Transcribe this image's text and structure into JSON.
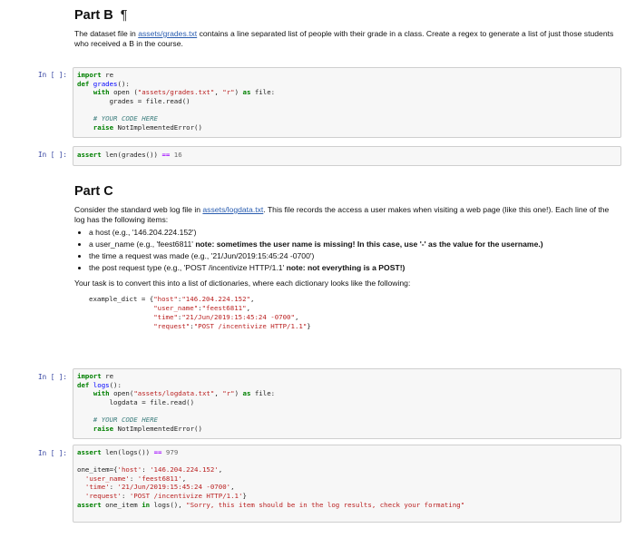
{
  "partB": {
    "title": "Part B",
    "pilcrow": "¶",
    "desc_pre": "The dataset file in ",
    "desc_link": "assets/grades.txt",
    "desc_post": " contains a line separated list of people with their grade in a class. Create a regex to generate a list of just those students who received a B in the course."
  },
  "prompts": {
    "cell": "In [ ]:"
  },
  "cell1": {
    "l1_kw": "import",
    "l1_rest": " re",
    "l2_kw": "def",
    "l2_fn": " grades",
    "l2_rest": "():",
    "l3_indent": "    ",
    "l3_kw": "with",
    "l3_a": " open (",
    "l3_s1": "\"assets/grades.txt\"",
    "l3_b": ", ",
    "l3_s2": "\"r\"",
    "l3_c": ") ",
    "l3_kw2": "as",
    "l3_d": " file:",
    "l4": "        grades = file.read()",
    "l6": "    # YOUR CODE HERE",
    "l7_kw": "    raise",
    "l7_rest": " NotImplementedError()"
  },
  "cell2": {
    "kw": "assert",
    "a": " len(grades()) ",
    "op": "==",
    "num": " 16"
  },
  "partC": {
    "title": "Part C",
    "p1_pre": "Consider the standard web log file in ",
    "p1_link": "assets/logdata.txt",
    "p1_post": ". This file records the access a user makes when visiting a web page (like this one!). Each line of the log has the following items:",
    "items": [
      {
        "text": "a host (e.g., '146.204.224.152')",
        "bold": ""
      },
      {
        "text": "a user_name (e.g., 'feest6811' ",
        "bold": "note: sometimes the user name is missing! In this case, use '-' as the value for the username.)"
      },
      {
        "text": "the time a request was made (e.g., '21/Jun/2019:15:45:24 -0700')",
        "bold": ""
      },
      {
        "text": "the post request type (e.g., 'POST /incentivize HTTP/1.1' ",
        "bold": "note: not everything is a POST!)"
      }
    ],
    "p2": "Your task is to convert this into a list of dictionaries, where each dictionary looks like the following:",
    "example": {
      "l1_a": "example_dict = {",
      "l1_k": "\"host\"",
      "l1_b": ":",
      "l1_v": "\"146.204.224.152\"",
      "l1_c": ",",
      "l2_k": "\"user_name\"",
      "l2_b": ":",
      "l2_v": "\"feest6811\"",
      "l2_c": ",",
      "l3_k": "\"time\"",
      "l3_b": ":",
      "l3_v": "\"21/Jun/2019:15:45:24 -0700\"",
      "l3_c": ",",
      "l4_k": "\"request\"",
      "l4_b": ":",
      "l4_v": "\"POST /incentivize HTTP/1.1\"",
      "l4_c": "}"
    }
  },
  "cell3": {
    "l1_kw": "import",
    "l1_rest": " re",
    "l2_kw": "def",
    "l2_fn": " logs",
    "l2_rest": "():",
    "l3_indent": "    ",
    "l3_kw": "with",
    "l3_a": " open(",
    "l3_s1": "\"assets/logdata.txt\"",
    "l3_b": ", ",
    "l3_s2": "\"r\"",
    "l3_c": ") ",
    "l3_kw2": "as",
    "l3_d": " file:",
    "l4": "        logdata = file.read()",
    "l6": "    # YOUR CODE HERE",
    "l7_kw": "    raise",
    "l7_rest": " NotImplementedError()"
  },
  "cell4": {
    "l1_kw": "assert",
    "l1_a": " len(logs()) ",
    "l1_op": "==",
    "l1_num": " 979",
    "l3_a": "one_item={",
    "l3_s1": "'host'",
    "l3_b": ": ",
    "l3_s2": "'146.204.224.152'",
    "l3_c": ",",
    "l4_i": "  ",
    "l4_s1": "'user_name'",
    "l4_b": ": ",
    "l4_s2": "'feest6811'",
    "l4_c": ",",
    "l5_i": "  ",
    "l5_s1": "'time'",
    "l5_b": ": ",
    "l5_s2": "'21/Jun/2019:15:45:24 -0700'",
    "l5_c": ",",
    "l6_i": "  ",
    "l6_s1": "'request'",
    "l6_b": ": ",
    "l6_s2": "'POST /incentivize HTTP/1.1'",
    "l6_c": "}",
    "l7_kw": "assert",
    "l7_a": " one_item ",
    "l7_kw2": "in",
    "l7_b": " logs(), ",
    "l7_s": "\"Sorry, this item should be in the log results, check your formating\""
  }
}
